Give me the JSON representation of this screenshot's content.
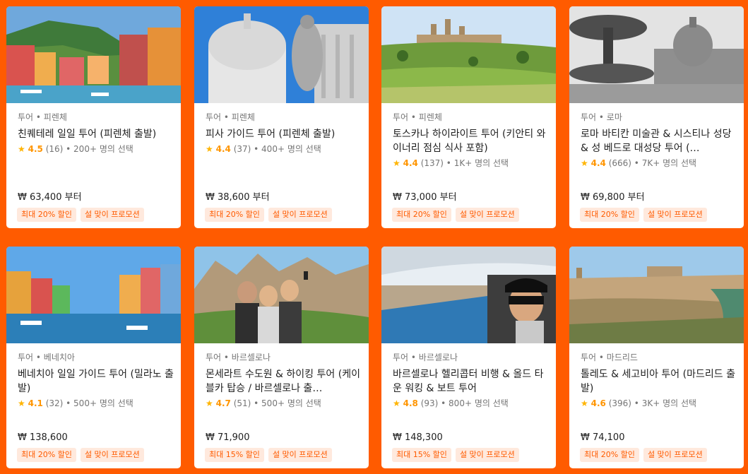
{
  "colors": {
    "background": "#ff5b00",
    "accent": "#ff5b00",
    "star": "#ffb400"
  },
  "cards": [
    {
      "meta": "투어 • 피렌체",
      "title": "친퀘테레 일일 투어 (피렌체 출발)",
      "star": "★",
      "score": "4.5",
      "reviews": "(16)",
      "booked": "• 200+ 명의 선택",
      "price": "₩ 63,400 부터",
      "badges": [
        "최대 20% 할인",
        "설 맞이 프로모션"
      ],
      "image": "cinque-terre-harbor"
    },
    {
      "meta": "투어 • 피렌체",
      "title": "피사 가이드 투어 (피렌체 출발)",
      "star": "★",
      "score": "4.4",
      "reviews": "(37)",
      "booked": "• 400+ 명의 선택",
      "price": "₩ 38,600 부터",
      "badges": [
        "최대 20% 할인",
        "설 맞이 프로모션"
      ],
      "image": "pisa-baptistery-statue"
    },
    {
      "meta": "투어 • 피렌체",
      "title": "토스카나 하이라이트 투어 (키안티 와이너리 점심 식사 포함)",
      "star": "★",
      "score": "4.4",
      "reviews": "(137)",
      "booked": "• 1K+ 명의 선택",
      "price": "₩ 73,000 부터",
      "badges": [
        "최대 20% 할인",
        "설 맞이 프로모션"
      ],
      "image": "tuscany-hill-town"
    },
    {
      "meta": "투어 • 로마",
      "title": "로마 바티칸 미술관 & 시스티나 성당 & 성 베드로 대성당 투어 (…",
      "star": "★",
      "score": "4.4",
      "reviews": "(666)",
      "booked": "• 7K+ 명의 선택",
      "price": "₩ 69,800 부터",
      "badges": [
        "최대 20% 할인",
        "설 맞이 프로모션"
      ],
      "image": "vatican-fountain"
    },
    {
      "meta": "투어 • 베네치아",
      "title": "베네치아 일일 가이드 투어 (밀라노 출발)",
      "star": "★",
      "score": "4.1",
      "reviews": "(32)",
      "booked": "• 500+ 명의 선택",
      "price": "₩ 138,600",
      "badges": [
        "최대 20% 할인",
        "설 맞이 프로모션"
      ],
      "image": "burano-canal"
    },
    {
      "meta": "투어 • 바르셀로나",
      "title": "몬세라트 수도원 & 하이킹 투어 (케이블카 탑승 / 바르셀로나 출…",
      "star": "★",
      "score": "4.7",
      "reviews": "(51)",
      "booked": "• 500+ 명의 선택",
      "price": "₩ 71,900",
      "badges": [
        "최대 15% 할인",
        "설 맞이 프로모션"
      ],
      "image": "montserrat-selfie"
    },
    {
      "meta": "투어 • 바르셀로나",
      "title": "바르셀로나 헬리콥터 비행 & 올드 타운 워킹 & 보트 투어",
      "star": "★",
      "score": "4.8",
      "reviews": "(93)",
      "booked": "• 800+ 명의 선택",
      "price": "₩ 148,300",
      "badges": [
        "최대 15% 할인",
        "설 맞이 프로모션"
      ],
      "image": "helicopter-barcelona"
    },
    {
      "meta": "투어 • 마드리드",
      "title": "톨레도 & 세고비아 투어 (마드리드 출발)",
      "star": "★",
      "score": "4.6",
      "reviews": "(396)",
      "booked": "• 3K+ 명의 선택",
      "price": "₩ 74,100",
      "badges": [
        "최대 20% 할인",
        "설 맞이 프로모션"
      ],
      "image": "toledo-panorama"
    }
  ]
}
